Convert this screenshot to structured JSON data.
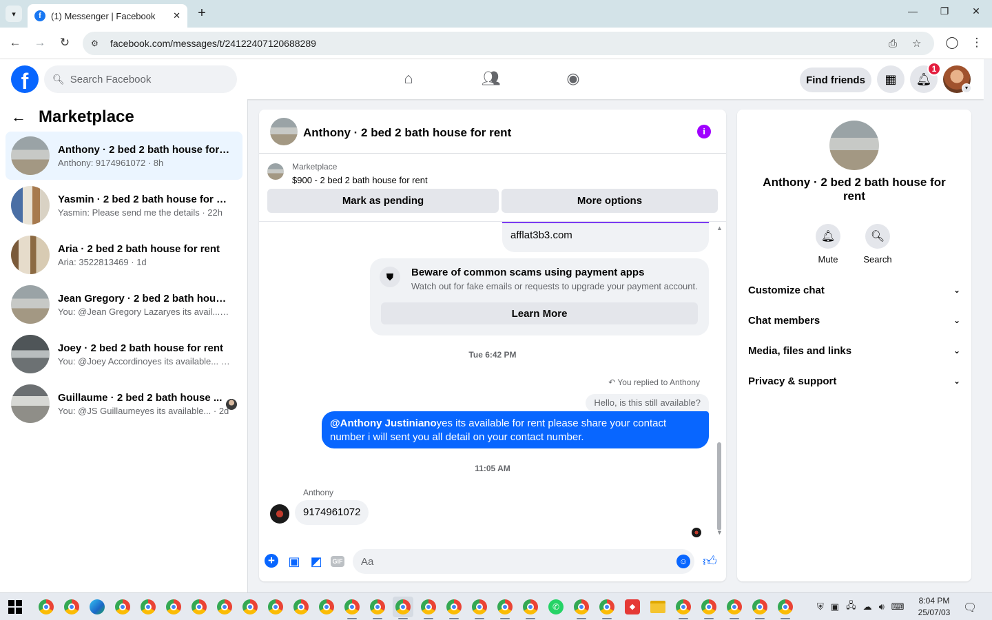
{
  "browser": {
    "tab_title": "(1) Messenger | Facebook",
    "url": "facebook.com/messages/t/24122407120688289"
  },
  "fb": {
    "search_placeholder": "Search Facebook",
    "find_friends": "Find friends",
    "notification_count": "1"
  },
  "sidebar": {
    "title": "Marketplace",
    "conversations": [
      {
        "name": "Anthony · 2 bed 2 bath house for r...",
        "preview": "Anthony: 9174961072 · 8h"
      },
      {
        "name": "Yasmin · 2 bed 2 bath house for rent",
        "preview": "Yasmin: Please send me the details · 22h"
      },
      {
        "name": "Aria · 2 bed 2 bath house for rent",
        "preview": "Aria: 3522813469 · 1d"
      },
      {
        "name": "Jean Gregory · 2 bed 2 bath house...",
        "preview": "You: @Jean Gregory Lazaryes its avail... · 2d"
      },
      {
        "name": "Joey · 2 bed 2 bath house for rent",
        "preview": "You: @Joey Accordinoyes its available... · 2d"
      },
      {
        "name": "Guillaume · 2 bed 2 bath house ...",
        "preview": "You: @JS Guillaumeyes its available... · 2d"
      }
    ]
  },
  "chat": {
    "title": "Anthony · 2 bed 2 bath house for rent",
    "marketplace_label": "Marketplace",
    "listing": "$900 - 2 bed 2 bath house for rent",
    "mark_pending": "Mark as pending",
    "more_options": "More options",
    "prev_bubble": "afflat3b3.com",
    "scam_title": "Beware of common scams using payment apps",
    "scam_desc": "Watch out for fake emails or requests to upgrade your payment account.",
    "learn_more": "Learn More",
    "timestamp1": "Tue 6:42 PM",
    "replied_to": "You replied to Anthony",
    "quoted": "Hello, is this still available?",
    "sent_mention": "@Anthony Justiniano",
    "sent_text": "yes its available for rent please share your contact number i will sent you all detail on your contact number.",
    "timestamp2": "11:05 AM",
    "sender": "Anthony",
    "received": "9174961072",
    "composer_placeholder": "Aa"
  },
  "details": {
    "name": "Anthony · 2 bed 2 bath house for rent",
    "mute": "Mute",
    "search": "Search",
    "sections": [
      "Customize chat",
      "Chat members",
      "Media, files and links",
      "Privacy & support"
    ]
  },
  "taskbar": {
    "time": "8:04 PM",
    "date": "25/07/03"
  },
  "colors": {
    "fb_blue": "#0866ff",
    "info_purple": "#a000ff",
    "notif_red": "#e41e3f"
  }
}
